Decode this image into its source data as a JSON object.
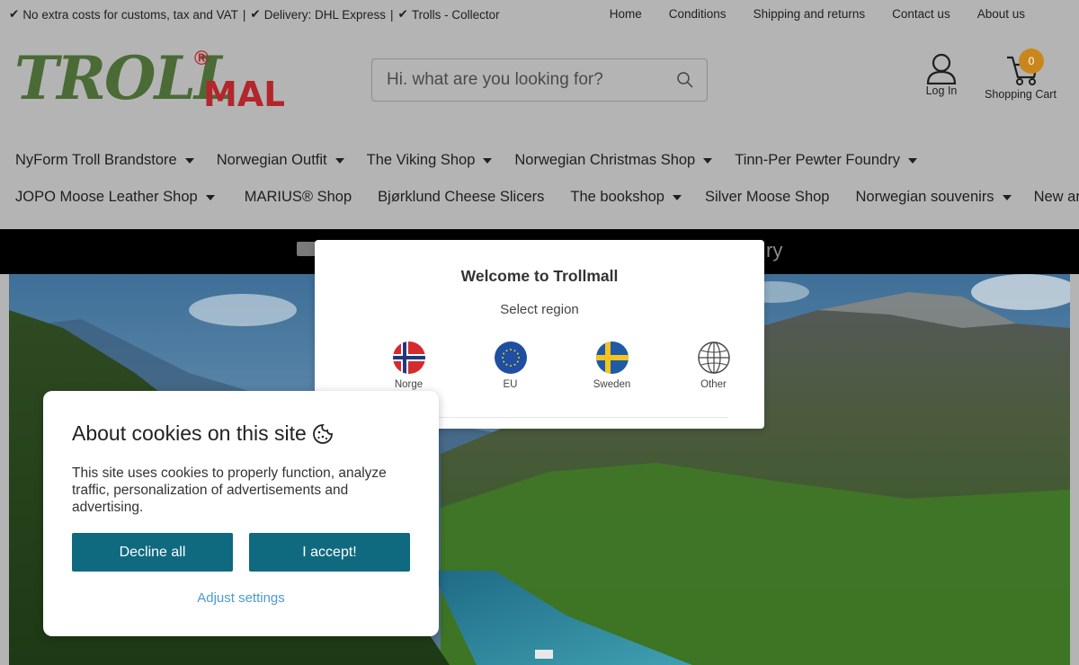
{
  "topbar": {
    "usp": [
      "No extra costs for customs, tax and VAT",
      "Delivery: DHL Express",
      "Trolls - Collector"
    ],
    "separator": "|",
    "links": [
      "Home",
      "Conditions",
      "Shipping and returns",
      "Contact us",
      "About us"
    ]
  },
  "header": {
    "logo_text_main": "TROLL",
    "logo_text_sub": "MALL",
    "logo_reg": "®",
    "search_placeholder": "Hi. what are you looking for?",
    "login_label": "Log In",
    "cart_label": "Shopping Cart",
    "cart_count": "0"
  },
  "nav": {
    "row1": [
      {
        "label": "NyForm Troll Brandstore",
        "dropdown": true
      },
      {
        "label": "Norwegian Outfit",
        "dropdown": true
      },
      {
        "label": "The Viking Shop",
        "dropdown": true
      },
      {
        "label": "Norwegian Christmas Shop",
        "dropdown": true
      },
      {
        "label": "Tinn-Per Pewter Foundry",
        "dropdown": true
      }
    ],
    "row2": [
      {
        "label": "JOPO Moose Leather Shop",
        "dropdown": true
      },
      {
        "label": "MARIUS® Shop",
        "dropdown": false
      },
      {
        "label": "Bjørklund Cheese Slicers",
        "dropdown": false
      },
      {
        "label": "The bookshop",
        "dropdown": true
      },
      {
        "label": "Silver Moose Shop",
        "dropdown": false
      },
      {
        "label": "Norwegian souvenirs",
        "dropdown": true
      },
      {
        "label": "New arrivals",
        "dropdown": false
      }
    ]
  },
  "strip": {
    "visible_tail": "ry"
  },
  "region_modal": {
    "title": "Welcome to Trollmall",
    "subtitle": "Select region",
    "options": [
      "Norge",
      "EU",
      "Sweden",
      "Other"
    ]
  },
  "cookie_modal": {
    "title": "About cookies on this site",
    "body": "This site uses cookies to properly function, analyze traffic, personalization of advertisements and advertising.",
    "decline_label": "Decline all",
    "accept_label": "I accept!",
    "adjust_label": "Adjust settings"
  },
  "colors": {
    "overlay_bg": "#b4b4b4",
    "button": "#0f6a80",
    "link": "#4a9bd0",
    "cart_badge": "#c9861c",
    "logo_green": "#4a6b35",
    "logo_red": "#b3262c"
  }
}
